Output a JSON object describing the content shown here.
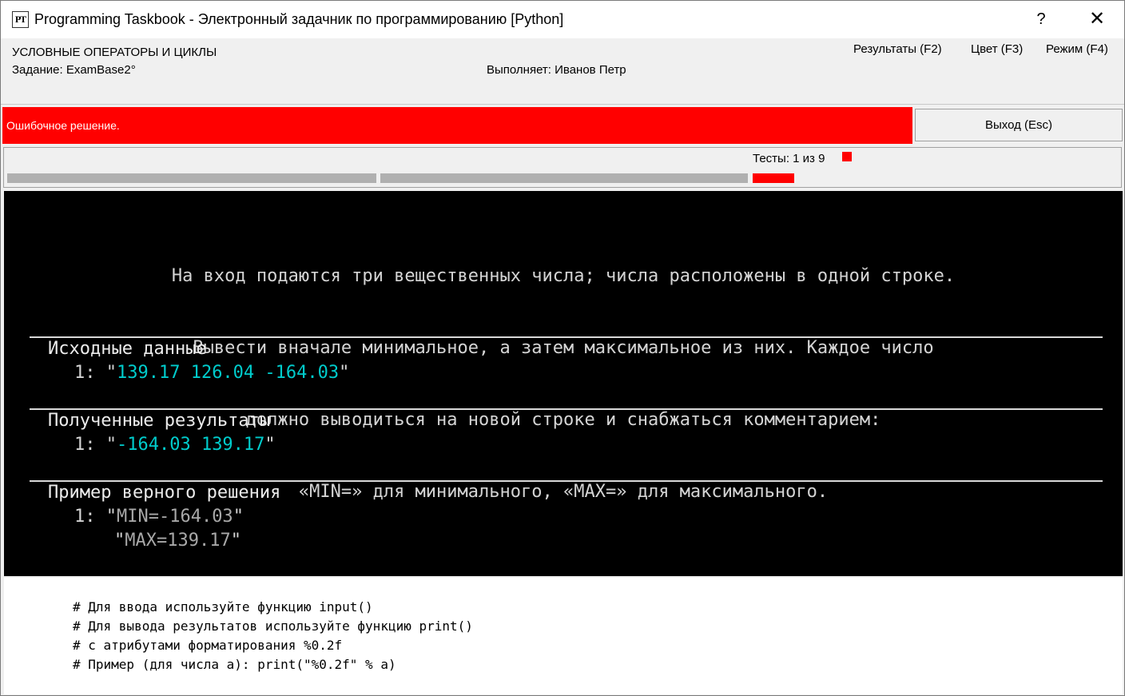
{
  "window": {
    "icon_text": "PT",
    "title": "Programming Taskbook - Электронный задачник по программированию [Python]",
    "help_label": "?",
    "close_label": "✕"
  },
  "header": {
    "section": "УСЛОВНЫЕ ОПЕРАТОРЫ И ЦИКЛЫ",
    "task": "Задание: ExamBase2°",
    "performer": "Выполняет: Иванов Петр",
    "menu": {
      "results": "Результаты (F2)",
      "color": "Цвет (F3)",
      "mode": "Режим (F4)"
    }
  },
  "status": {
    "message": "Ошибочное решение.",
    "exit_label": "Выход (Esc)"
  },
  "tests": {
    "label": "Тесты:  1 из 9",
    "current": 1,
    "total": 9,
    "status_color": "#ff0000"
  },
  "task": {
    "description": [
      "На вход подаются три вещественных числа; числа расположены в одной строке.",
      "Вывести вначале минимальное, а затем максимальное из них. Каждое число",
      "должно выводиться на новой строке и снабжаться комментарием:",
      "«MIN=» для минимального, «MAX=» для максимального."
    ],
    "input": {
      "heading": "Исходные данные",
      "prefix": "1: \"",
      "value": "139.17 126.04 -164.03",
      "suffix": "\""
    },
    "output": {
      "heading": "Полученные результаты",
      "prefix": "1: \"",
      "value": "-164.03 139.17",
      "suffix": "\""
    },
    "example": {
      "heading": "Пример верного решения",
      "prefix": "1: \"",
      "line1": "MIN=-164.03",
      "line2": "MAX=139.17",
      "quote": "\""
    }
  },
  "code_hints": [
    "# Для ввода используйте функцию input()",
    "# Для вывода результатов используйте функцию print()",
    "# с атрибутами форматирования %0.2f",
    "# Пример (для числа a): print(\"%0.2f\" % a)"
  ]
}
